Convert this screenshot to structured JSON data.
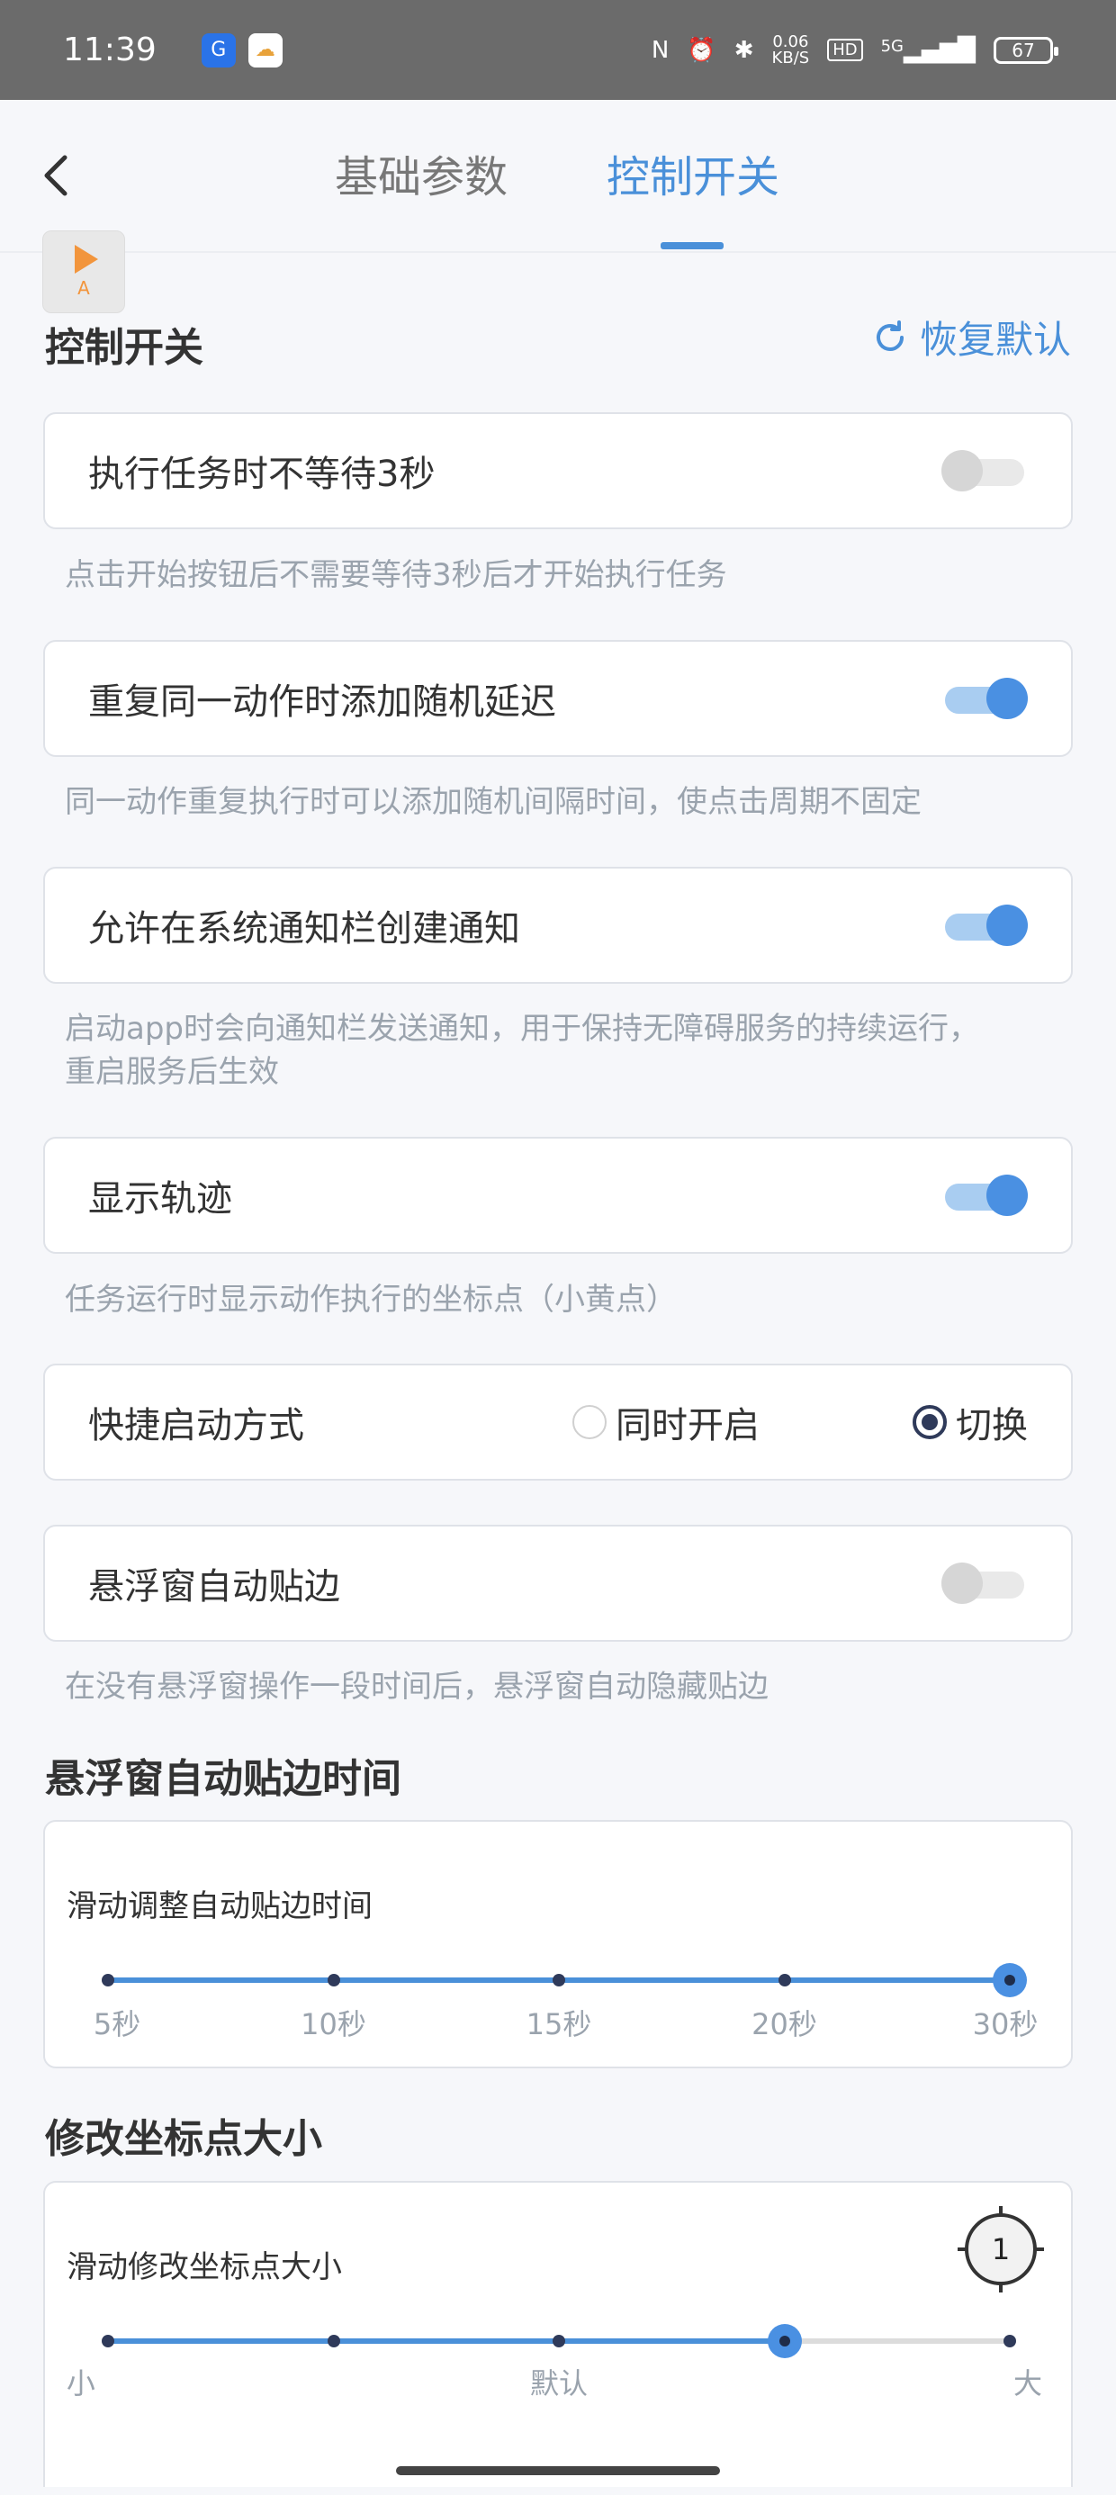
{
  "status_bar": {
    "time": "11:39",
    "net_speed_value": "0.06",
    "net_speed_unit": "KB/S",
    "hd_label": "HD",
    "network": "5G",
    "battery": "67"
  },
  "header": {
    "tabs": [
      {
        "label": "基础参数",
        "active": false
      },
      {
        "label": "控制开关",
        "active": true
      }
    ]
  },
  "float_window": {
    "label": "A"
  },
  "control": {
    "section_title": "控制开关",
    "reset_label": "恢复默认",
    "items": [
      {
        "label": "执行任务时不等待3秒",
        "on": false,
        "desc": "点击开始按钮后不需要等待3秒后才开始执行任务"
      },
      {
        "label": "重复同一动作时添加随机延迟",
        "on": true,
        "desc": "同一动作重复执行时可以添加随机间隔时间，使点击周期不固定"
      },
      {
        "label": "允许在系统通知栏创建通知",
        "on": true,
        "desc_line1": "启动app时会向通知栏发送通知，用于保持无障碍服务的持续运行，",
        "desc_line2": "重启服务后生效"
      },
      {
        "label": "显示轨迹",
        "on": true,
        "desc": "任务运行时显示动作执行的坐标点（小黄点）"
      }
    ],
    "quick_start": {
      "label": "快捷启动方式",
      "options": [
        "同时开启",
        "切换"
      ],
      "selected": "切换"
    },
    "auto_edge": {
      "label": "悬浮窗自动贴边",
      "on": false,
      "desc": "在没有悬浮窗操作一段时间后，悬浮窗自动隐藏贴边"
    }
  },
  "edge_time": {
    "section_title": "悬浮窗自动贴边时间",
    "slider_title": "滑动调整自动贴边时间",
    "ticks": [
      "5秒",
      "10秒",
      "15秒",
      "20秒",
      "30秒"
    ],
    "value_fraction": 1.0
  },
  "point_size": {
    "section_title": "修改坐标点大小",
    "slider_title": "滑动修改坐标点大小",
    "preview_value": "1",
    "labels": [
      "小",
      "默认",
      "大"
    ],
    "value_fraction": 0.75
  },
  "colors": {
    "accent": "#4a90d9",
    "toggle_on": "#4a90e2",
    "desc_text": "#9aa3ad"
  }
}
